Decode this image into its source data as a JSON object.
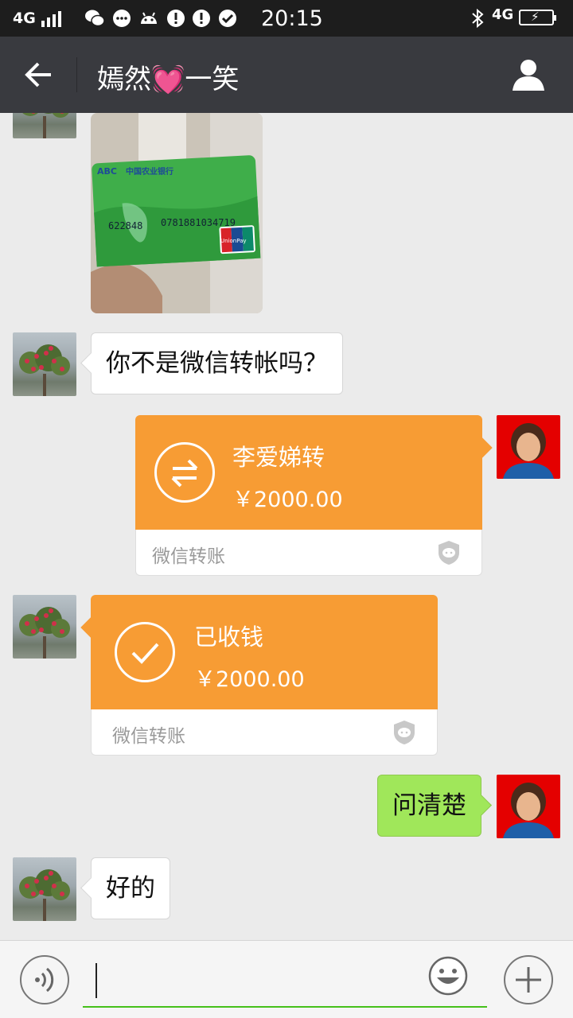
{
  "status_bar": {
    "network_left": "4G",
    "time": "20:15",
    "network_right": "4G"
  },
  "header": {
    "back_icon": "arrow-left-icon",
    "title_prefix": "嫣然",
    "title_emoji": "💓",
    "title_suffix": "一笑",
    "profile_icon": "person-icon"
  },
  "messages": [
    {
      "type": "image",
      "side": "left",
      "description_icon": "bank-card-photo"
    },
    {
      "type": "text",
      "side": "left",
      "text": "你不是微信转帐吗？"
    },
    {
      "type": "transfer",
      "side": "right",
      "title": "李爱娣转",
      "amount": "￥2000.00",
      "label": "微信转账",
      "icon": "transfer-arrows-icon"
    },
    {
      "type": "transfer",
      "side": "left",
      "title": "已收钱",
      "amount": "￥2000.00",
      "label": "微信转账",
      "icon": "check-icon"
    },
    {
      "type": "text",
      "side": "right",
      "text": "问清楚"
    },
    {
      "type": "text",
      "side": "left",
      "text": "好的"
    }
  ],
  "card_photo": {
    "bank_name": "中国农业银行",
    "bank_code": "ABC",
    "card_number_left": "622848",
    "card_number_right": "0781881034719",
    "unionpay": "UnionPay"
  },
  "input_bar": {
    "value": "",
    "voice_icon": "voice-icon",
    "emoji_icon": "emoji-icon",
    "plus_icon": "plus-icon"
  },
  "colors": {
    "title_bar": "#393a3f",
    "transfer_orange": "#f79c34",
    "my_bubble": "#a0e75a",
    "input_underline": "#45c01a"
  }
}
